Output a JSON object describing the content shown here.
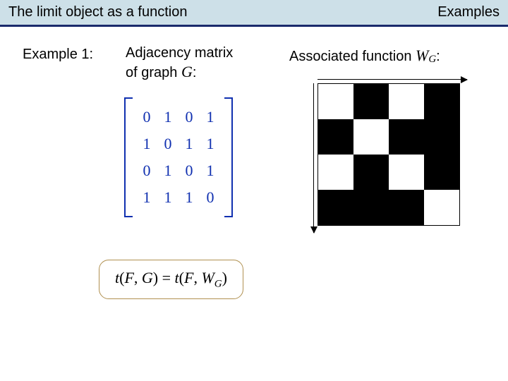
{
  "header": {
    "title_left": "The limit object as a function",
    "title_right": "Examples"
  },
  "example": {
    "label": "Example 1:",
    "adjacency_heading_line1": "Adjacency matrix",
    "adjacency_heading_line2_prefix": "of graph ",
    "graph_var": "G",
    "colon": ":",
    "associated_heading_prefix": "Associated function ",
    "func_W": "W",
    "func_sub": "G"
  },
  "adjacency_matrix": [
    [
      0,
      1,
      0,
      1
    ],
    [
      1,
      0,
      1,
      1
    ],
    [
      0,
      1,
      0,
      1
    ],
    [
      1,
      1,
      1,
      0
    ]
  ],
  "graphon_colors": [
    [
      "w",
      "b",
      "w",
      "b"
    ],
    [
      "b",
      "w",
      "b",
      "b"
    ],
    [
      "w",
      "b",
      "w",
      "b"
    ],
    [
      "b",
      "b",
      "b",
      "w"
    ]
  ],
  "equation": {
    "t": "t",
    "F": "F",
    "G": "G",
    "eq": " = ",
    "W": "W",
    "Wsub": "G",
    "open": "(",
    "close": ")",
    "comma": ", "
  }
}
